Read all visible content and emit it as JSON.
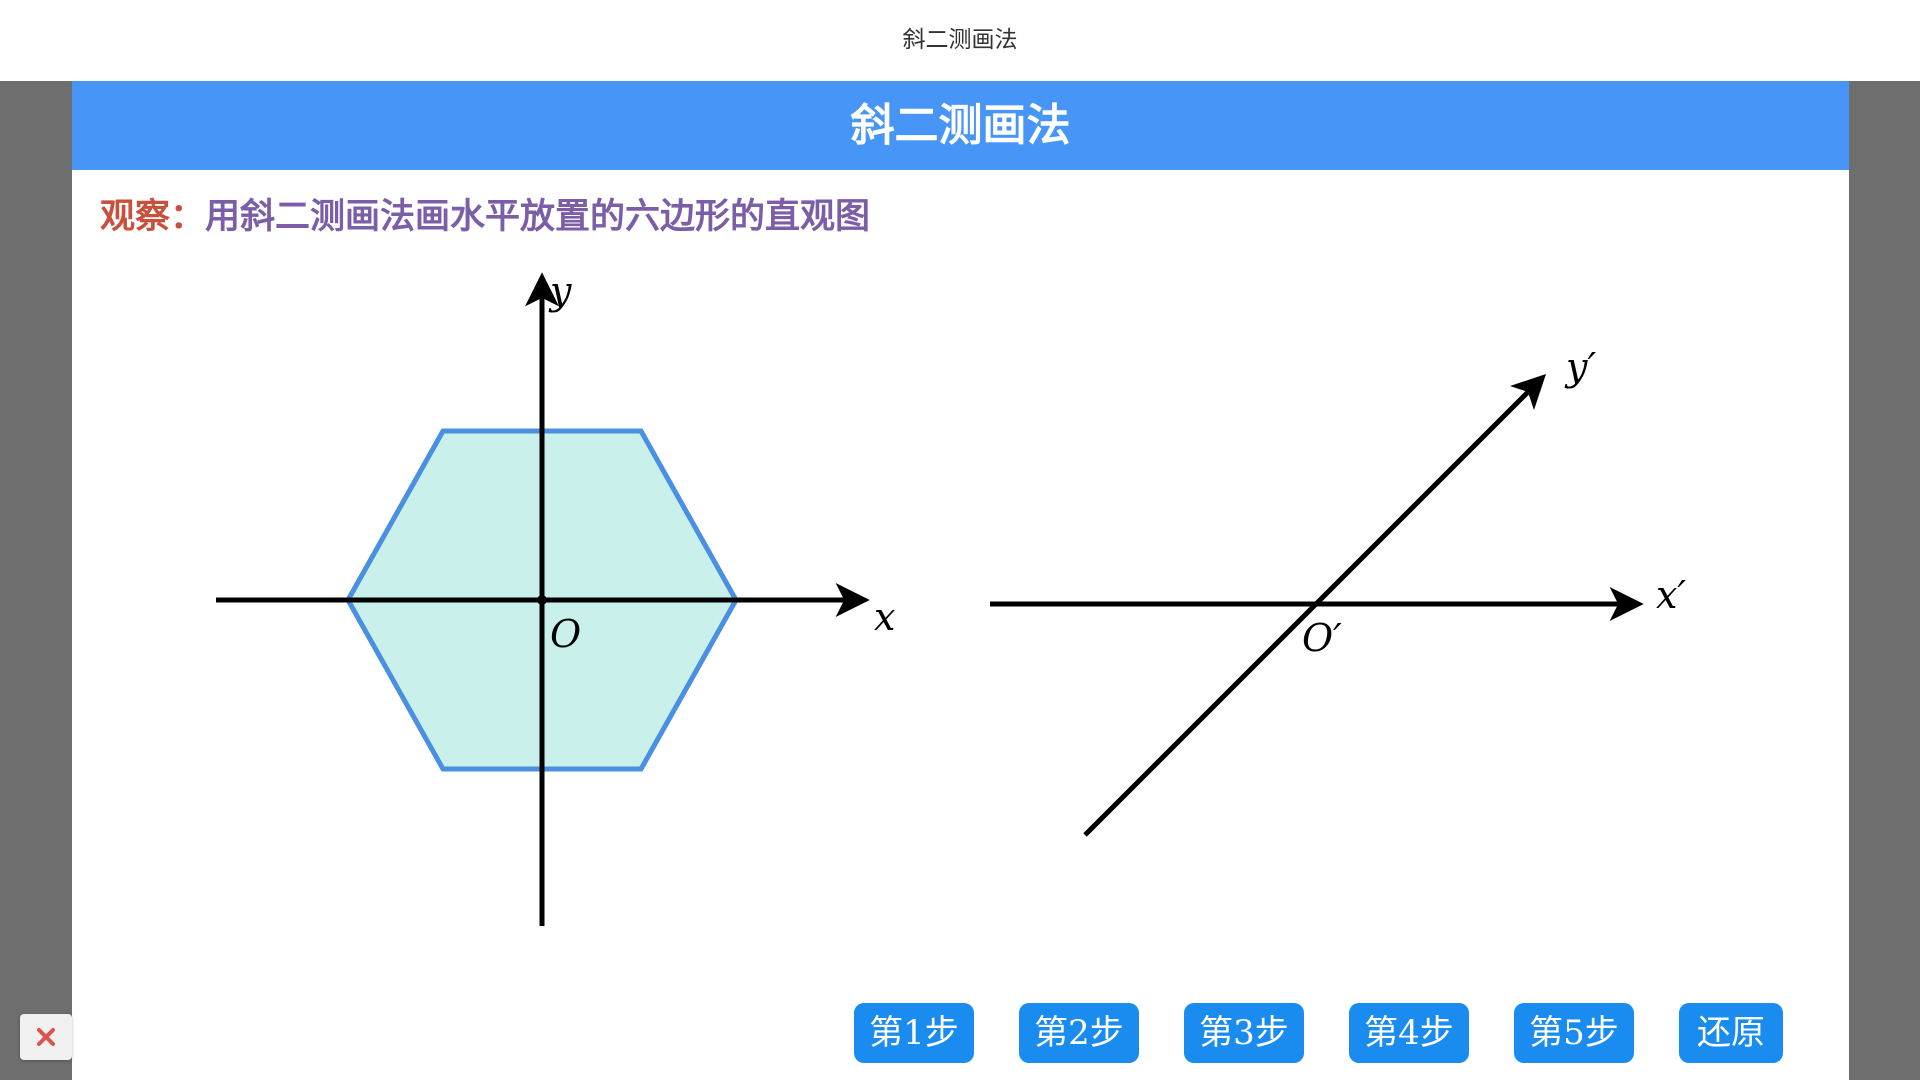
{
  "window": {
    "title": "斜二测画法"
  },
  "banner": {
    "title": "斜二测画法"
  },
  "prompt": {
    "lead": "观察：",
    "text": "用斜二测画法画水平放置的六边形的直观图"
  },
  "figure": {
    "original": {
      "x_label": "x",
      "y_label": "y",
      "origin_label": "O",
      "hexagon_fill": "#c9f0ea",
      "hexagon_stroke": "#4a8fe0"
    },
    "oblique": {
      "x_label": "x′",
      "y_label": "y′",
      "origin_label": "O′"
    }
  },
  "controls": {
    "steps": [
      "第1步",
      "第2步",
      "第3步",
      "第4步",
      "第5步"
    ],
    "reset": "还原",
    "close_icon": "close-icon"
  },
  "colors": {
    "banner": "#4796f7",
    "button": "#1a8cf0",
    "lead_text": "#c8513d",
    "prompt_text": "#7b5ea7",
    "close_icon": "#d9534f"
  }
}
